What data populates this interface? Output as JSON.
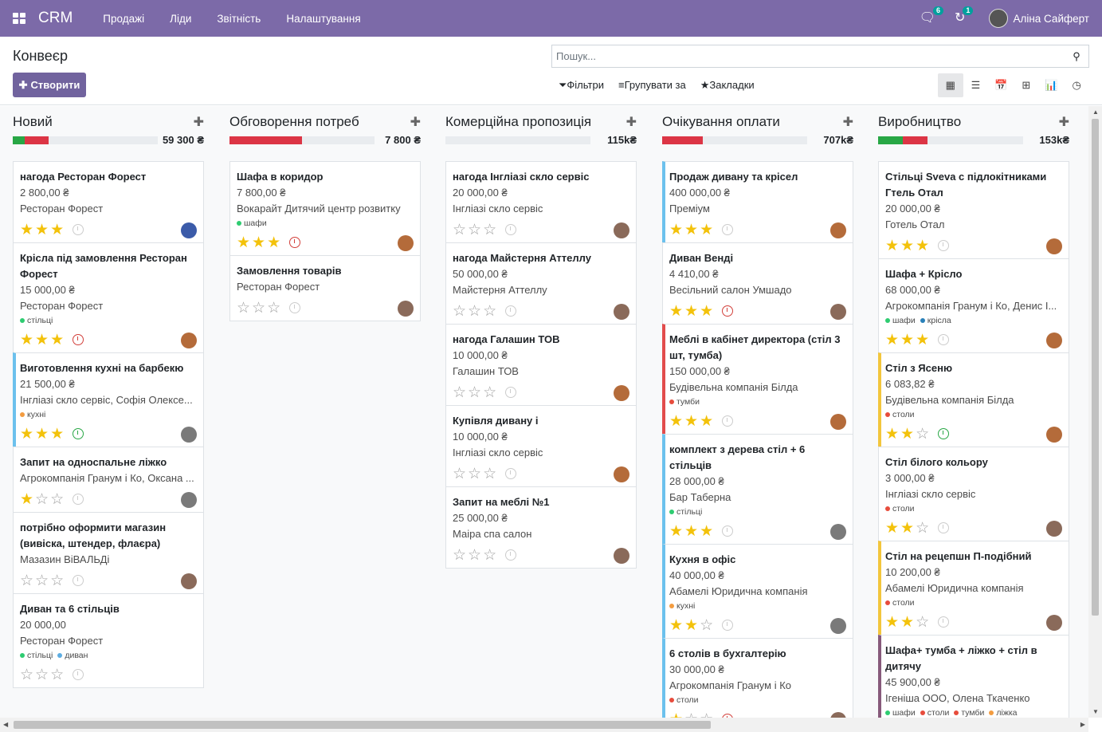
{
  "topbar": {
    "brand": "CRM",
    "menu": [
      "Продажі",
      "Ліди",
      "Звітність",
      "Налаштування"
    ],
    "messages_badge": "6",
    "activities_badge": "1",
    "user_name": "Аліна Сайферт"
  },
  "control_panel": {
    "title": "Конвеєр",
    "create_label": "Створити",
    "search_placeholder": "Пошук...",
    "filters_label": "Фільтри",
    "group_label": "Групувати за",
    "favorites_label": "Закладки"
  },
  "columns": [
    {
      "name": "Новий",
      "total": "59 300 ₴",
      "progress": [
        {
          "color": "#28a745",
          "pct": 8
        },
        {
          "color": "#dc3545",
          "pct": 17
        }
      ],
      "cards": [
        {
          "title": "нагода Ресторан Форест",
          "lines": [
            "2 800,00 ₴",
            "Ресторан Форест"
          ],
          "tags": [],
          "stars": 3,
          "activity": "grey",
          "avatar": "#3b5ba9",
          "border": ""
        },
        {
          "title": "Крісла під замовлення Ресторан Форест",
          "lines": [
            "15 000,00 ₴",
            "Ресторан Форест"
          ],
          "tags": [
            {
              "name": "стільці",
              "color": "#2ecc71"
            }
          ],
          "stars": 3,
          "activity": "red",
          "avatar": "#b46b3a",
          "border": ""
        },
        {
          "title": "Виготовлення кухні на барбекю",
          "lines": [
            "21 500,00 ₴",
            "Інгліазі скло сервіс, Софія Олексе..."
          ],
          "tags": [
            {
              "name": "кухні",
              "color": "#f39c40"
            }
          ],
          "stars": 3,
          "activity": "green",
          "avatar": "#7a7a7a",
          "border": "bl-blue"
        },
        {
          "title": "Запит на односпальне ліжко",
          "lines": [
            "Агрокомпанія Гранум і Ко, Оксана ..."
          ],
          "tags": [],
          "stars": 1,
          "activity": "grey",
          "avatar": "#7a7a7a",
          "border": ""
        },
        {
          "title": "потрібно оформити магазин (вивіска, штендер, флаєра)",
          "lines": [
            "Мазазин ВіВАЛЬДі"
          ],
          "tags": [],
          "stars": 0,
          "activity": "grey",
          "avatar": "#8a6a5a",
          "border": ""
        },
        {
          "title": "Диван та 6 стільців",
          "lines": [
            "20 000,00",
            "Ресторан Форест"
          ],
          "tags": [
            {
              "name": "стільці",
              "color": "#2ecc71"
            },
            {
              "name": "диван",
              "color": "#5dade2"
            }
          ],
          "stars": 0,
          "activity": "grey",
          "avatar": "",
          "border": ""
        }
      ]
    },
    {
      "name": "Обговорення потреб",
      "total": "7 800 ₴",
      "progress": [
        {
          "color": "#dc3545",
          "pct": 50
        }
      ],
      "cards": [
        {
          "title": "Шафа в коридор",
          "lines": [
            "7 800,00 ₴",
            "Вокарайт Дитячий центр розвитку"
          ],
          "tags": [
            {
              "name": "шафи",
              "color": "#2ecc71"
            }
          ],
          "stars": 3,
          "activity": "red",
          "avatar": "#b46b3a",
          "border": ""
        },
        {
          "title": "Замовлення товарів",
          "lines": [
            "Ресторан Форест"
          ],
          "tags": [],
          "stars": 0,
          "activity": "grey",
          "avatar": "#8a6a5a",
          "border": ""
        }
      ]
    },
    {
      "name": "Комерційна пропозиція",
      "total": "115k₴",
      "progress": [],
      "cards": [
        {
          "title": "нагода Інгліазі скло сервіс",
          "lines": [
            "20 000,00 ₴",
            "Інгліазі скло сервіс"
          ],
          "tags": [],
          "stars": 0,
          "activity": "grey",
          "avatar": "#8a6a5a",
          "border": ""
        },
        {
          "title": "нагода Майстерня Аттеллу",
          "lines": [
            "50 000,00 ₴",
            "Майстерня Аттеллу"
          ],
          "tags": [],
          "stars": 0,
          "activity": "grey",
          "avatar": "#8a6a5a",
          "border": ""
        },
        {
          "title": "нагода Галашин ТОВ",
          "lines": [
            "10 000,00 ₴",
            "Галашин ТОВ"
          ],
          "tags": [],
          "stars": 0,
          "activity": "grey",
          "avatar": "#b46b3a",
          "border": ""
        },
        {
          "title": "Купівля дивану і",
          "lines": [
            "10 000,00 ₴",
            "Інгліазі скло сервіс"
          ],
          "tags": [],
          "stars": 0,
          "activity": "grey",
          "avatar": "#b46b3a",
          "border": ""
        },
        {
          "title": "Запит на меблі №1",
          "lines": [
            "25 000,00 ₴",
            "Маіра спа салон"
          ],
          "tags": [],
          "stars": 0,
          "activity": "grey",
          "avatar": "#8a6a5a",
          "border": ""
        }
      ]
    },
    {
      "name": "Очікування оплати",
      "total": "707k₴",
      "progress": [
        {
          "color": "#dc3545",
          "pct": 28
        }
      ],
      "cards": [
        {
          "title": "Продаж дивану та крісел",
          "lines": [
            "400 000,00 ₴",
            "Преміум"
          ],
          "tags": [],
          "stars": 3,
          "activity": "grey",
          "avatar": "#b46b3a",
          "border": "bl-blue"
        },
        {
          "title": "Диван Венді",
          "lines": [
            "4 410,00 ₴",
            "Весільний салон Умшадо"
          ],
          "tags": [],
          "stars": 3,
          "activity": "red",
          "avatar": "#8a6a5a",
          "border": ""
        },
        {
          "title": "Меблі в кабінет директора (стіл 3 шт, тумба)",
          "lines": [
            "150 000,00 ₴",
            "Будівельна компанія Білда"
          ],
          "tags": [
            {
              "name": "тумби",
              "color": "#e74c3c"
            }
          ],
          "stars": 3,
          "activity": "grey",
          "avatar": "#b46b3a",
          "border": "bl-red"
        },
        {
          "title": "комплект з дерева стіл + 6 стільців",
          "lines": [
            "28 000,00 ₴",
            "Бар Таберна"
          ],
          "tags": [
            {
              "name": "стільці",
              "color": "#2ecc71"
            }
          ],
          "stars": 3,
          "activity": "grey",
          "avatar": "#7a7a7a",
          "border": "bl-blue"
        },
        {
          "title": "Кухня в офіс",
          "lines": [
            "40 000,00 ₴",
            "Абамелі Юридична компанія"
          ],
          "tags": [
            {
              "name": "кухні",
              "color": "#f39c40"
            }
          ],
          "stars": 2,
          "activity": "grey",
          "avatar": "#7a7a7a",
          "border": "bl-blue"
        },
        {
          "title": "6 столів в бухгалтерію",
          "lines": [
            "30 000,00 ₴",
            "Агрокомпанія Гранум і Ко"
          ],
          "tags": [
            {
              "name": "столи",
              "color": "#e74c3c"
            }
          ],
          "stars": 1,
          "activity": "red",
          "avatar": "#8a6a5a",
          "border": "bl-blue"
        }
      ]
    },
    {
      "name": "Виробництво",
      "total": "153k₴",
      "progress": [
        {
          "color": "#28a745",
          "pct": 17
        },
        {
          "color": "#dc3545",
          "pct": 17
        }
      ],
      "cards": [
        {
          "title": "Стільці Sveva с підлокітниками Гтель Отал",
          "lines": [
            "20 000,00 ₴",
            "Готель Отал"
          ],
          "tags": [],
          "stars": 3,
          "activity": "grey",
          "avatar": "#b46b3a",
          "border": ""
        },
        {
          "title": "Шафа + Крісло",
          "lines": [
            "68 000,00 ₴",
            "Агрокомпанія Гранум і Ко, Денис І..."
          ],
          "tags": [
            {
              "name": "шафи",
              "color": "#2ecc71"
            },
            {
              "name": "крісла",
              "color": "#2980b9"
            }
          ],
          "stars": 3,
          "activity": "grey",
          "avatar": "#b46b3a",
          "border": ""
        },
        {
          "title": "Стіл з Ясеню",
          "lines": [
            "6 083,82 ₴",
            "Будівельна компанія Білда"
          ],
          "tags": [
            {
              "name": "столи",
              "color": "#e74c3c"
            }
          ],
          "stars": 2,
          "activity": "green",
          "avatar": "#b46b3a",
          "border": "bl-yellow"
        },
        {
          "title": "Стіл білого кольору",
          "lines": [
            "3 000,00 ₴",
            "Інгліазі скло сервіс"
          ],
          "tags": [
            {
              "name": "столи",
              "color": "#e74c3c"
            }
          ],
          "stars": 2,
          "activity": "grey",
          "avatar": "#8a6a5a",
          "border": ""
        },
        {
          "title": "Стіл на рецепшн П-подібний",
          "lines": [
            "10 200,00 ₴",
            "Абамелі Юридична компанія"
          ],
          "tags": [
            {
              "name": "столи",
              "color": "#e74c3c"
            }
          ],
          "stars": 2,
          "activity": "grey",
          "avatar": "#8a6a5a",
          "border": "bl-yellow"
        },
        {
          "title": "Шафа+ тумба + ліжко + стіл в дитячу",
          "lines": [
            "45 900,00 ₴",
            "Ігеніша ООО, Олена Ткаченко"
          ],
          "tags": [
            {
              "name": "шафи",
              "color": "#2ecc71"
            },
            {
              "name": "столи",
              "color": "#e74c3c"
            },
            {
              "name": "тумби",
              "color": "#e74c3c"
            },
            {
              "name": "ліжка",
              "color": "#f39c40"
            }
          ],
          "stars": 0,
          "activity": "none",
          "avatar": "",
          "border": "bl-purple"
        }
      ]
    }
  ]
}
